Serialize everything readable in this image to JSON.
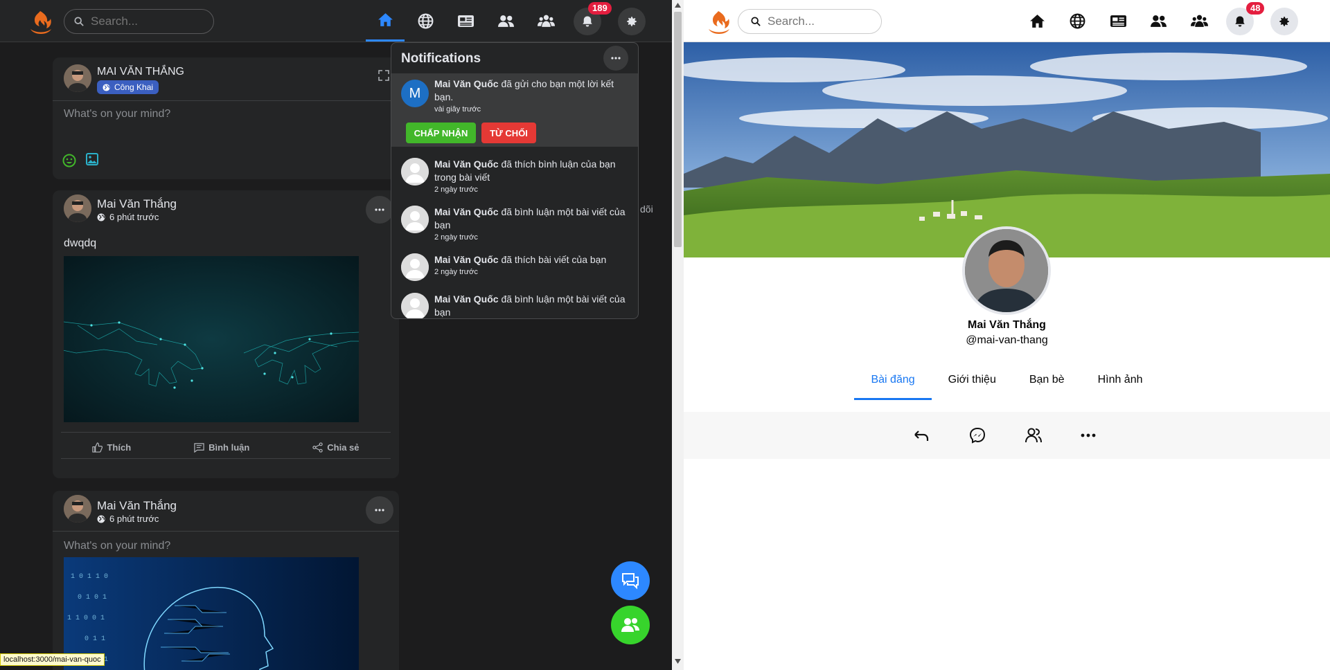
{
  "left": {
    "search_placeholder": "Search...",
    "notif_badge": "189",
    "composer": {
      "user": "MAI VĂN THẮNG",
      "privacy": "Công Khai",
      "placeholder": "What's on your mind?"
    },
    "post1": {
      "user": "Mai Văn Thắng",
      "time": "6 phút trước",
      "text": "dwqdq",
      "like": "Thích",
      "comment": "Bình luận",
      "share": "Chia sẻ"
    },
    "post2": {
      "user": "Mai Văn Thắng",
      "time": "6 phút trước",
      "placeholder": "What's on your mind?"
    },
    "behind_text": "dõi",
    "notifications": {
      "title": "Notifications",
      "items": [
        {
          "name": "Mai Văn Quốc",
          "text": " đã gửi cho bạn một lời kết bạn.",
          "time": "vài giây trước",
          "initial": "M"
        },
        {
          "name": "Mai Văn Quốc",
          "text": " đã thích bình luận của bạn trong bài viết",
          "time": "2 ngày trước"
        },
        {
          "name": "Mai Văn Quốc",
          "text": " đã bình luận một bài viết của bạn",
          "time": "2 ngày trước"
        },
        {
          "name": "Mai Văn Quốc",
          "text": " đã thích bài viết của bạn",
          "time": "2 ngày trước"
        },
        {
          "name": "Mai Văn Quốc",
          "text": " đã bình luận một bài viết của bạn",
          "time": ""
        }
      ],
      "accept": "CHẤP NHẬN",
      "reject": "TỪ CHỐI"
    },
    "status_url": "localhost:3000/mai-van-quoc"
  },
  "right": {
    "search_placeholder": "Search...",
    "notif_badge": "48",
    "profile": {
      "name": "Mai Văn Thắng",
      "handle": "@mai-van-thang"
    },
    "tabs": [
      "Bài đăng",
      "Giới thiệu",
      "Bạn bè",
      "Hình ảnh"
    ]
  },
  "colors": {
    "accent": "#2d88ff",
    "accept": "#42b72a",
    "reject": "#e53935",
    "badge": "#e41e3f",
    "dark_bg": "#1c1c1d",
    "card_bg": "#242526"
  }
}
